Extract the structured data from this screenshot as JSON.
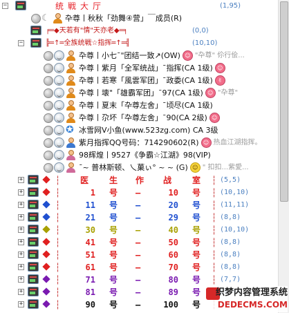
{
  "tree": {
    "header": {
      "title": "统戦大厅",
      "count": "(1,95)"
    },
    "group1": {
      "label": "卆尊丨秋秋「劲舞④营」￣成员(R)"
    },
    "sub1": {
      "label": "╒═◆天若有\"情\"天亦老◆═╕",
      "count": "(0,0)"
    },
    "sub2": {
      "label": "╠═↑═全族统戦☆指挥═↑═╣",
      "count": "(10,10)"
    },
    "members": [
      {
        "name": "卆尊丨小七ˉ\"团结一致↗(OW)",
        "note": "\"卆尊\" 伱行侩...",
        "sticker": "☺",
        "person": "orange"
      },
      {
        "name": "卆尊丨紫月「全军统战」ˉ指挥(CA 1级)",
        "note": "",
        "sticker": "☺",
        "person": "orange"
      },
      {
        "name": "卆尊丨若寒「風雲军团」ˉ政委(CA 1级)",
        "note": "",
        "sticker": "✌",
        "person": "orange"
      },
      {
        "name": "卆尊丨壊\"「雄霸军团」ˉ97(CA 1级)",
        "note": "\"卆尊\"",
        "sticker": "☺",
        "person": "orange"
      },
      {
        "name": "卆尊丨夏末「卆尊左舍」ˉ顷尽(CA 1级)",
        "note": "",
        "sticker": "",
        "person": "orange"
      },
      {
        "name": "卆尊丨尕坏「卆尊左舍」ˉ90(CA 2级)",
        "note": "",
        "sticker": "☺",
        "person": "orange"
      },
      {
        "name": "冰雪网Ⅴ小鱼(www.523zg.com) CA 3级",
        "note": "",
        "sticker": "",
        "person": "star"
      },
      {
        "name": "紫月指挥QQ号码：714290602(R)",
        "note": "热血江湖指挥。",
        "sticker": "☺",
        "person": "blue"
      },
      {
        "name": "98辉煌丨9527《争霸☆江湖》98(VIP)",
        "note": "",
        "sticker": "",
        "person": "pink"
      },
      {
        "name": "ˉ~ 普林斯顿、乀菓ぃ° ~ ~ (G)",
        "note": "\" 扣扣...紫愛...",
        "sticker": "☺",
        "person": "pink"
      }
    ],
    "table_header": {
      "col1": "医",
      "col2": "生",
      "col3": "作",
      "col4": "战",
      "col5": "室",
      "count": "(5,5)"
    },
    "rooms": [
      {
        "from": "1",
        "mid": "号",
        "dash": "—",
        "to": "10",
        "unit": "号",
        "count": "(10,10)",
        "color": "#e02020",
        "diamond": "#e02020"
      },
      {
        "from": "11",
        "mid": "号",
        "dash": "—",
        "to": "20",
        "unit": "号",
        "count": "(11,11)",
        "color": "#2050d0",
        "diamond": "#2050d0"
      },
      {
        "from": "21",
        "mid": "号",
        "dash": "—",
        "to": "29",
        "unit": "号",
        "count": "(8,8)",
        "color": "#2050d0",
        "diamond": "#2050d0"
      },
      {
        "from": "30",
        "mid": "号",
        "dash": "—",
        "to": "40",
        "unit": "号",
        "count": "(10,10)",
        "color": "#a8a000",
        "diamond": "#a8a000"
      },
      {
        "from": "41",
        "mid": "号",
        "dash": "—",
        "to": "50",
        "unit": "号",
        "count": "(8,8)",
        "color": "#e02020",
        "diamond": "#e02020"
      },
      {
        "from": "51",
        "mid": "号",
        "dash": "—",
        "to": "60",
        "unit": "号",
        "count": "(8,8)",
        "color": "#e02020",
        "diamond": "#e02020"
      },
      {
        "from": "61",
        "mid": "号",
        "dash": "—",
        "to": "70",
        "unit": "号",
        "count": "(8,8)",
        "color": "#e02020",
        "diamond": "#e02020"
      },
      {
        "from": "71",
        "mid": "号",
        "dash": "—",
        "to": "80",
        "unit": "号",
        "count": "(7,7)",
        "color": "#7a1ab0",
        "diamond": "#7a1ab0"
      },
      {
        "from": "81",
        "mid": "号",
        "dash": "—",
        "to": "89",
        "unit": "号",
        "count": "(8,8)",
        "color": "#7a1ab0",
        "diamond": "#7a1ab0"
      },
      {
        "from": "90",
        "mid": "号",
        "dash": "—",
        "to": "100",
        "unit": "号",
        "count": "",
        "color": "#111111",
        "diamond": "#7a1ab0"
      }
    ]
  },
  "watermark": {
    "main": "织梦内容管理系统",
    "sub": "DEDECMS.COM"
  }
}
